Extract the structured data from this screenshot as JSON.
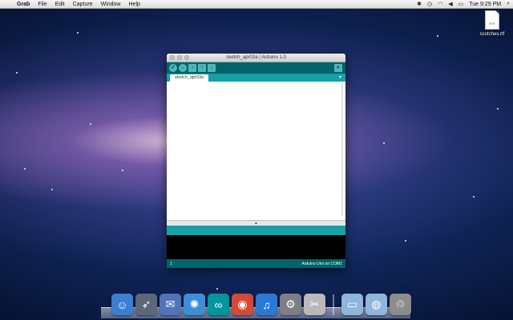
{
  "menubar": {
    "app_name": "Grab",
    "items": [
      "File",
      "Edit",
      "Capture",
      "Window",
      "Help"
    ],
    "clock": "Tue 9:29 PM"
  },
  "desktop": {
    "file_name": "scotches.rtf",
    "file_ext": "RTF"
  },
  "window": {
    "title": "sketch_apr03a | Arduino 1.0",
    "tab_label": "sketch_apr03a",
    "status_line": "1",
    "status_board": "Arduino Uno on COM1",
    "divider_glyph": "▲"
  },
  "dock": {
    "items": [
      {
        "name": "finder",
        "glyph": "☺",
        "color": "#3b7fd0"
      },
      {
        "name": "launchpad",
        "glyph": "➶",
        "color": "#5e6778"
      },
      {
        "name": "mail",
        "glyph": "✉",
        "color": "#4f74b8"
      },
      {
        "name": "safari",
        "glyph": "✺",
        "color": "#3c8fd6"
      },
      {
        "name": "arduino",
        "glyph": "∞",
        "color": "#00979c"
      },
      {
        "name": "chrome",
        "glyph": "◉",
        "color": "#d44a37"
      },
      {
        "name": "itunes",
        "glyph": "♫",
        "color": "#2a7ad8"
      },
      {
        "name": "system-preferences",
        "glyph": "⚙",
        "color": "#7d7f84"
      },
      {
        "name": "grab",
        "glyph": "✂",
        "color": "#b9b9b9"
      }
    ],
    "stacks": [
      {
        "name": "applications-folder",
        "glyph": "▭",
        "color": "#8fb6dc"
      },
      {
        "name": "downloads-folder",
        "glyph": "◍",
        "color": "#8fb6dc"
      },
      {
        "name": "trash",
        "glyph": "♲",
        "color": "#8c8c8c"
      }
    ]
  }
}
